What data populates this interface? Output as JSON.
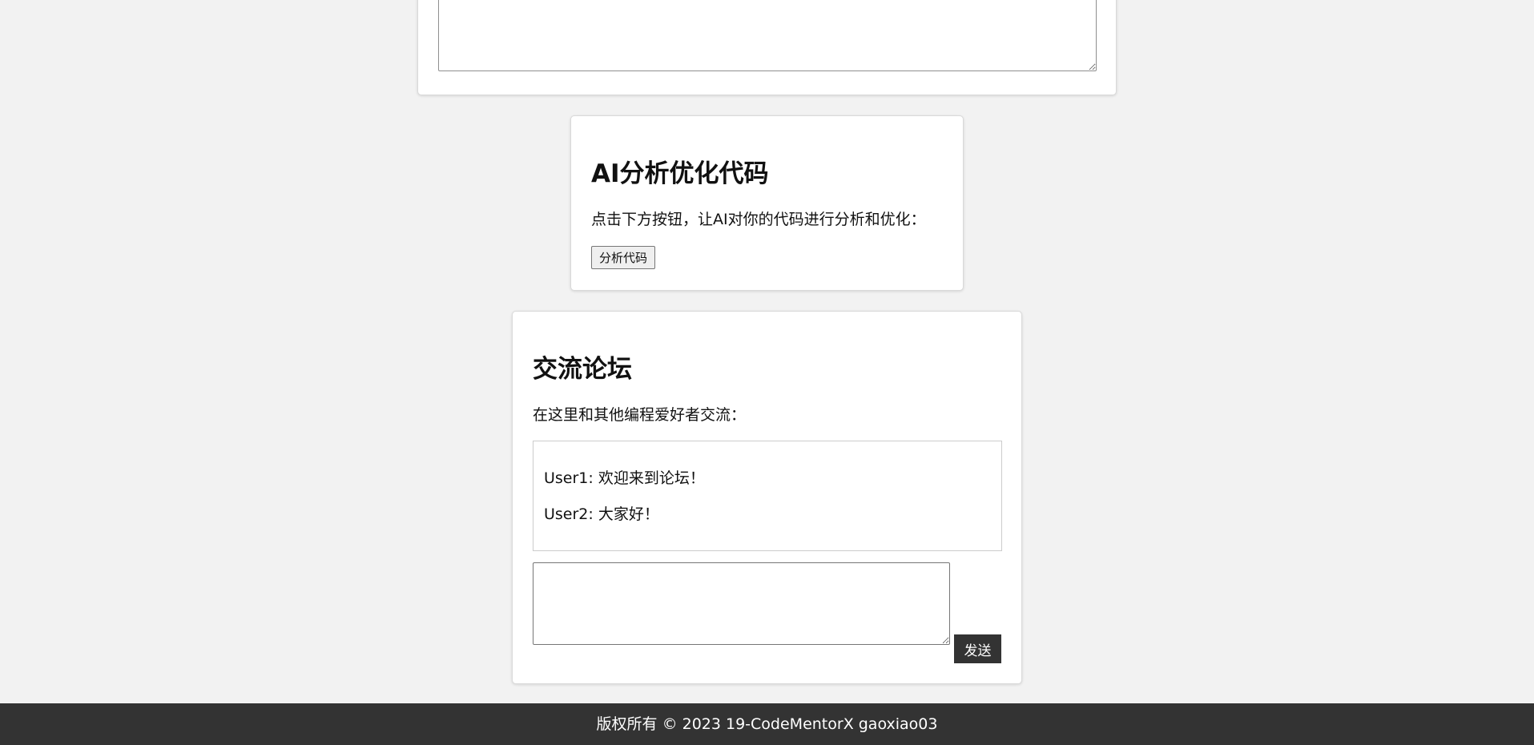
{
  "ai_section": {
    "title": "AI分析优化代码",
    "description": "点击下方按钮，让AI对你的代码进行分析和优化：",
    "analyze_button": "分析代码"
  },
  "forum": {
    "title": "交流论坛",
    "description": "在这里和其他编程爱好者交流：",
    "messages": [
      "User1: 欢迎来到论坛！",
      "User2: 大家好！"
    ],
    "message_input_value": "",
    "send_button": "发送"
  },
  "editor": {
    "value": ""
  },
  "footer": {
    "text": "版权所有 © 2023 19-CodeMentorX gaoxiao03"
  },
  "colors": {
    "background": "#f2f2f2",
    "card": "#ffffff",
    "dark_accent": "#333333"
  }
}
